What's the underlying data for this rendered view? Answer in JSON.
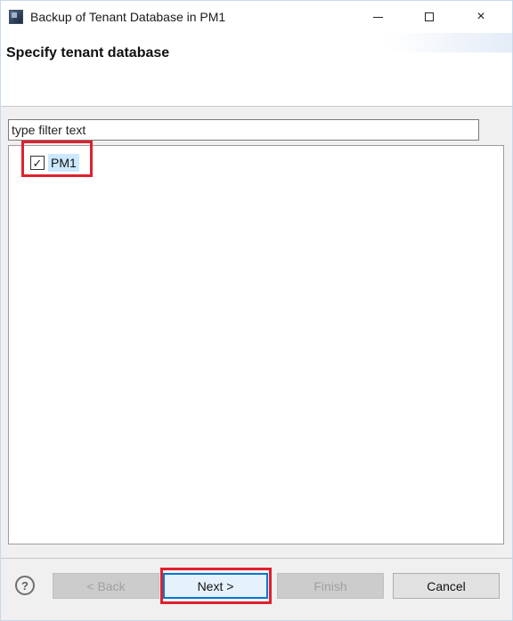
{
  "window": {
    "title": "Backup of Tenant Database in PM1",
    "icon": "eclipse-app-icon",
    "controls": {
      "minimize": "minimize-icon",
      "maximize": "maximize-icon",
      "close": "×"
    }
  },
  "header": {
    "title": "Specify tenant database"
  },
  "filter": {
    "value": "",
    "placeholder": "type filter text"
  },
  "tree": {
    "items": [
      {
        "label": "PM1",
        "checked": true,
        "check_glyph": "✓"
      }
    ]
  },
  "buttons": {
    "help": "?",
    "back": "< Back",
    "next": "Next >",
    "finish": "Finish",
    "cancel": "Cancel"
  },
  "colors": {
    "highlight": "#e0202e",
    "selection": "#cce8ff",
    "focus_border": "#0078d7"
  }
}
